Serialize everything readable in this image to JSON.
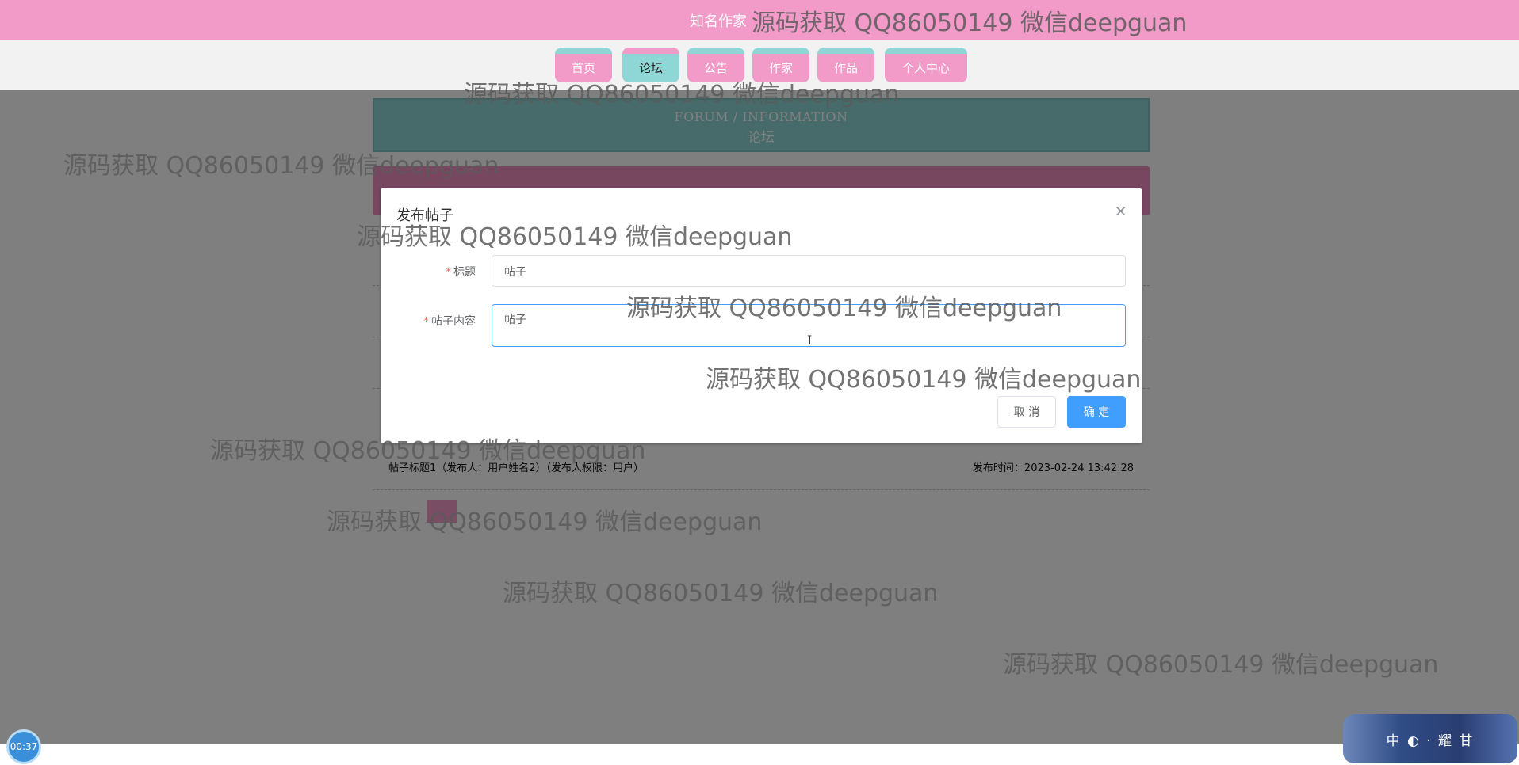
{
  "header": {
    "site_title": "知名作家"
  },
  "nav": {
    "items": [
      {
        "label": "首页"
      },
      {
        "label": "论坛"
      },
      {
        "label": "公告"
      },
      {
        "label": "作家"
      },
      {
        "label": "作品"
      },
      {
        "label": "个人中心"
      }
    ],
    "active_index": 1
  },
  "banner": {
    "title_en": "FORUM / INFORMATION",
    "title_zh": "论坛"
  },
  "post": {
    "title_line": "帖子标题1（发布人：用户姓名2）（发布人权限：用户）",
    "time_line": "发布时间：2023-02-24 13:42:28"
  },
  "dialog": {
    "title": "发布帖子",
    "close_symbol": "×",
    "fields": {
      "title_label": "标题",
      "title_value": "帖子",
      "content_label": "帖子内容",
      "content_value": "帖子"
    },
    "required_mark": "*",
    "cancel_label": "取 消",
    "confirm_label": "确 定"
  },
  "watermark_text": "源码获取 QQ86050149 微信deepguan",
  "timer": "00:37",
  "ime_badge": "中 ◐ · 耀 甘",
  "colors": {
    "primary": "#409eff",
    "accent_pink": "#f29bc8",
    "accent_teal": "#8fd6d7",
    "required": "#f56c6c"
  }
}
